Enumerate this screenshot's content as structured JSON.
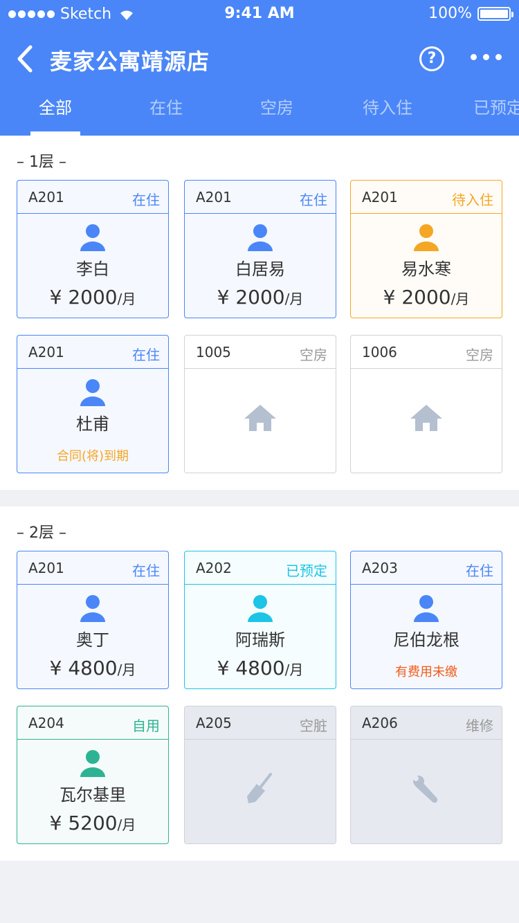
{
  "statusbar": {
    "carrier": "Sketch",
    "time": "9:41 AM",
    "battery": "100%"
  },
  "nav": {
    "title": "麦家公寓靖源店",
    "help": "?"
  },
  "tabs": [
    {
      "label": "全部"
    },
    {
      "label": "在住"
    },
    {
      "label": "空房"
    },
    {
      "label": "待入住"
    },
    {
      "label": "已预定"
    }
  ],
  "floors": [
    {
      "label": "– 1层 –",
      "rooms": [
        {
          "room": "A201",
          "status": "在住",
          "name": "李白",
          "price": "¥ 2000",
          "unit": "/月",
          "color": "#4a86f7"
        },
        {
          "room": "A201",
          "status": "在住",
          "name": "白居易",
          "price": "¥ 2000",
          "unit": "/月",
          "color": "#4a86f7"
        },
        {
          "room": "A201",
          "status": "待入住",
          "name": "易水寒",
          "price": "¥ 2000",
          "unit": "/月",
          "color": "#f5a623"
        },
        {
          "room": "A201",
          "status": "在住",
          "name": "杜甫",
          "note": "合同(将)到期",
          "note_color": "#f5a623",
          "color": "#4a86f7"
        },
        {
          "room": "1005",
          "status": "空房",
          "icon": "house-icon"
        },
        {
          "room": "1006",
          "status": "空房",
          "icon": "house-icon"
        }
      ]
    },
    {
      "label": "– 2层 –",
      "rooms": [
        {
          "room": "A201",
          "status": "在住",
          "name": "奥丁",
          "price": "¥ 4800",
          "unit": "/月",
          "color": "#4a86f7"
        },
        {
          "room": "A202",
          "status": "已预定",
          "name": "阿瑞斯",
          "price": "¥ 4800",
          "unit": "/月",
          "color": "#1cc4e6"
        },
        {
          "room": "A203",
          "status": "在住",
          "name": "尼伯龙根",
          "note": "有费用未缴",
          "note_color": "#f25c1a",
          "color": "#4a86f7"
        },
        {
          "room": "A204",
          "status": "自用",
          "name": "瓦尔基里",
          "price": "¥ 5200",
          "unit": "/月",
          "color": "#2db393"
        },
        {
          "room": "A205",
          "status": "空脏",
          "icon": "broom-icon"
        },
        {
          "room": "A206",
          "status": "维修",
          "icon": "wrench-icon"
        }
      ]
    }
  ]
}
